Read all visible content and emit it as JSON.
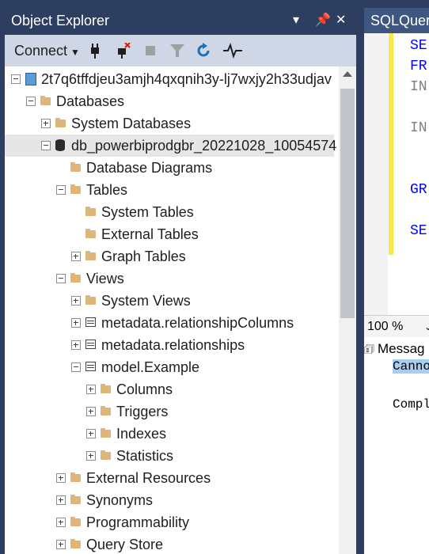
{
  "object_explorer": {
    "title": "Object Explorer",
    "toolbar": {
      "connect_label": "Connect"
    },
    "tree": [
      {
        "label": "2t7q6tffdjeu3amjh4qxqnih3y-lj7wxjy2h33udjav",
        "level": 0,
        "expander": "minus",
        "icon": "server"
      },
      {
        "label": "Databases",
        "level": 1,
        "expander": "minus",
        "icon": "folder"
      },
      {
        "label": "System Databases",
        "level": 2,
        "expander": "plus",
        "icon": "folder"
      },
      {
        "label": "db_powerbiprodgbr_20221028_10054574",
        "level": 2,
        "expander": "minus",
        "icon": "database",
        "selected": true
      },
      {
        "label": "Database Diagrams",
        "level": 3,
        "expander": "none",
        "icon": "folder"
      },
      {
        "label": "Tables",
        "level": 3,
        "expander": "minus",
        "icon": "folder"
      },
      {
        "label": "System Tables",
        "level": 4,
        "expander": "none",
        "icon": "folder"
      },
      {
        "label": "External Tables",
        "level": 4,
        "expander": "none",
        "icon": "folder"
      },
      {
        "label": "Graph Tables",
        "level": 4,
        "expander": "plus",
        "icon": "folder"
      },
      {
        "label": "Views",
        "level": 3,
        "expander": "minus",
        "icon": "folder"
      },
      {
        "label": "System Views",
        "level": 4,
        "expander": "plus",
        "icon": "folder"
      },
      {
        "label": "metadata.relationshipColumns",
        "level": 4,
        "expander": "plus",
        "icon": "table"
      },
      {
        "label": "metadata.relationships",
        "level": 4,
        "expander": "plus",
        "icon": "table"
      },
      {
        "label": "model.Example",
        "level": 4,
        "expander": "minus",
        "icon": "table"
      },
      {
        "label": "Columns",
        "level": 5,
        "expander": "plus",
        "icon": "folder"
      },
      {
        "label": "Triggers",
        "level": 5,
        "expander": "plus",
        "icon": "folder"
      },
      {
        "label": "Indexes",
        "level": 5,
        "expander": "plus",
        "icon": "folder"
      },
      {
        "label": "Statistics",
        "level": 5,
        "expander": "plus",
        "icon": "folder"
      },
      {
        "label": "External Resources",
        "level": 3,
        "expander": "plus",
        "icon": "folder"
      },
      {
        "label": "Synonyms",
        "level": 3,
        "expander": "plus",
        "icon": "folder"
      },
      {
        "label": "Programmability",
        "level": 3,
        "expander": "plus",
        "icon": "folder"
      },
      {
        "label": "Query Store",
        "level": 3,
        "expander": "plus",
        "icon": "folder"
      }
    ]
  },
  "editor": {
    "tab_title": "SQLQuery",
    "code_lines": [
      {
        "text": "SE",
        "color": "#0000ff"
      },
      {
        "text": "FR",
        "color": "#0000ff"
      },
      {
        "text": "IN",
        "color": "#808080"
      },
      {
        "text": "",
        "color": "#000000"
      },
      {
        "text": "IN",
        "color": "#808080"
      },
      {
        "text": "",
        "color": "#000000"
      },
      {
        "text": "",
        "color": "#000000"
      },
      {
        "text": "GR",
        "color": "#0000ff"
      },
      {
        "text": "",
        "color": "#000000"
      },
      {
        "text": "SE",
        "color": "#0000ff"
      }
    ],
    "zoom": "100 %",
    "messages_tab": "Messag",
    "messages": [
      {
        "text": "Canno",
        "highlight": true
      },
      {
        "text": "",
        "highlight": false
      },
      {
        "text": "Compl",
        "highlight": false
      }
    ]
  }
}
